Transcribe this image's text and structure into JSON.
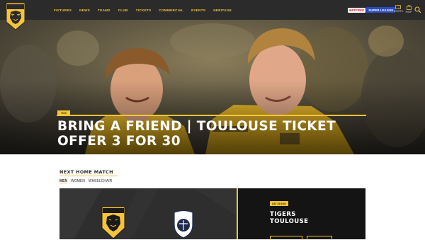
{
  "header": {
    "logo_icon": "castleford-tigers-crest-icon",
    "nav": [
      "FIXTURES",
      "NEWS",
      "TEAMS",
      "CLUB",
      "TICKETS",
      "COMMERCIAL",
      "EVENTS",
      "HERITAGE"
    ],
    "sponsor": {
      "betfred": "BETFRED",
      "superleague": "SUPER LEAGUE"
    },
    "tickets_label": "TICKETS",
    "shop_label": "SHOP",
    "search_icon": "search-icon"
  },
  "hero": {
    "tag": "TIXS",
    "title": "BRING A FRIEND | TOULOUSE TICKET OFFER 3 FOR 30"
  },
  "next_match": {
    "heading": "NEXT HOME MATCH",
    "tabs": [
      "MEN",
      "WOMEN",
      "WHEELCHAIR"
    ],
    "date_badge": "SAT 23 AUG",
    "home_team": "TIGERS",
    "away_team": "TOULOUSE"
  },
  "colors": {
    "accent": "#f6c33a",
    "header_bg": "#2b2b2b",
    "match_left_bg": "#2e2e2e",
    "match_right_bg": "#141414"
  }
}
